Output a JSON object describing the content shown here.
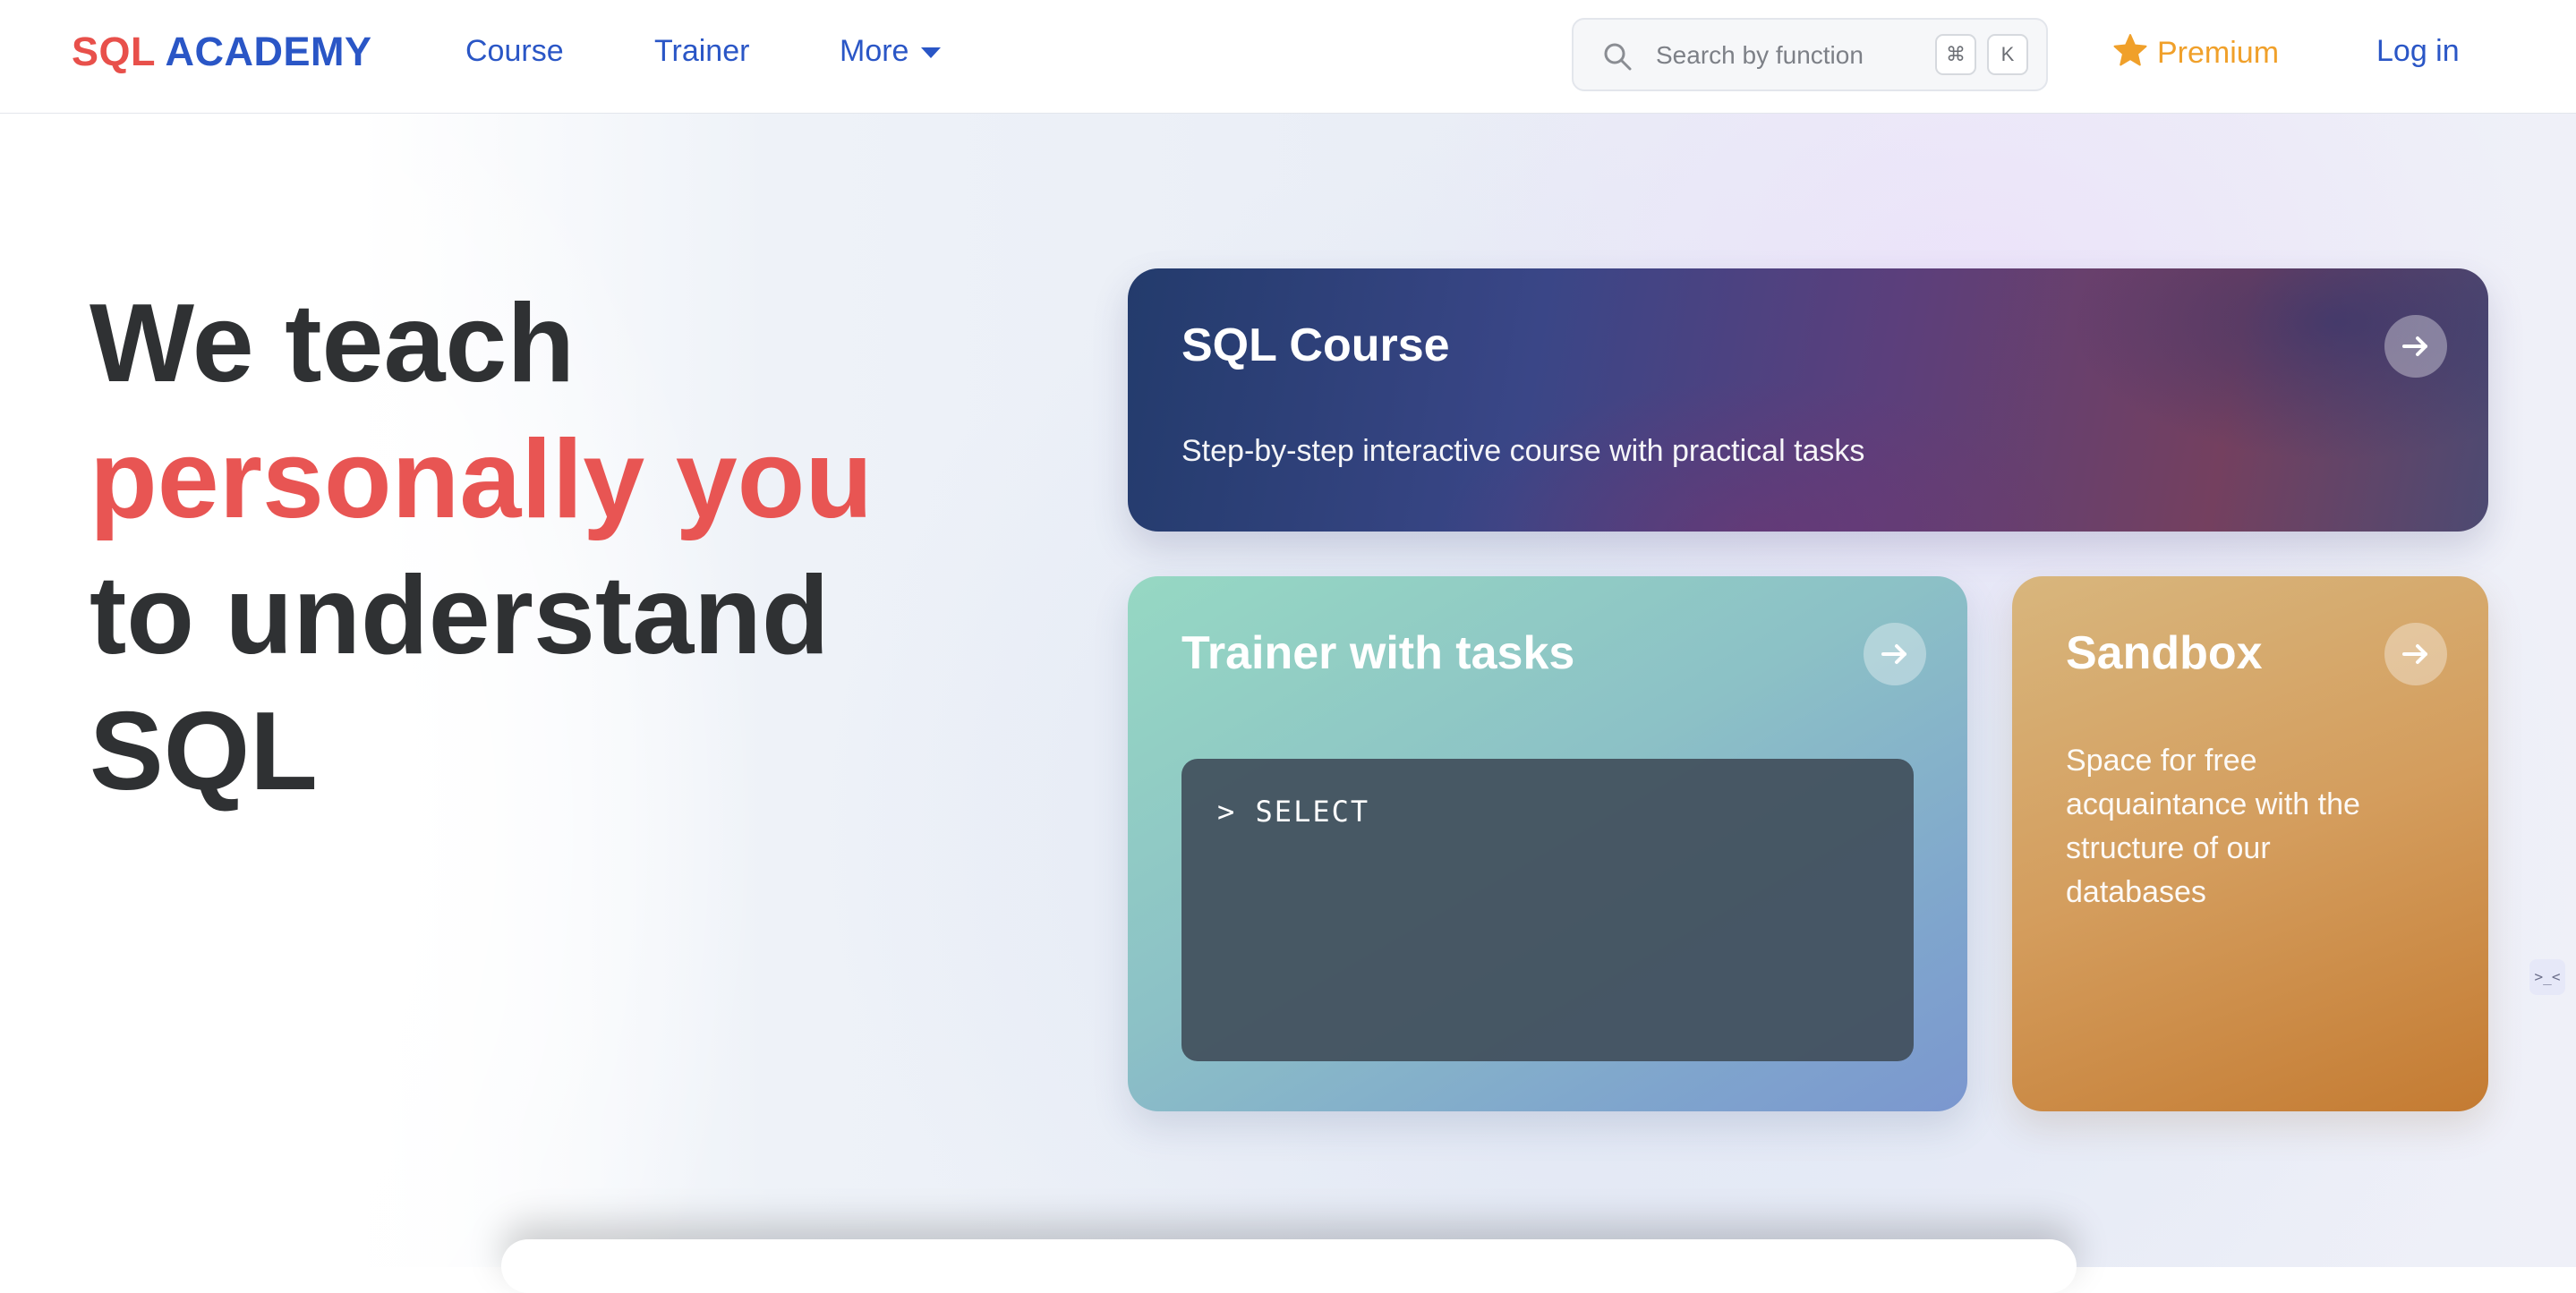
{
  "header": {
    "logo": {
      "part1": "SQL",
      "part2": "ACADEMY"
    },
    "nav": {
      "course": "Course",
      "trainer": "Trainer",
      "more": "More"
    },
    "search": {
      "placeholder": "Search by function",
      "shortcut_cmd": "⌘",
      "shortcut_key": "K"
    },
    "premium": "Premium",
    "login": "Log in"
  },
  "hero": {
    "line1": "We teach",
    "line2": "personally you",
    "line3": "to understand",
    "line4": "SQL"
  },
  "cards": {
    "course": {
      "title": "SQL Course",
      "description": "Step-by-step interactive course with practical tasks"
    },
    "trainer": {
      "title": "Trainer with tasks",
      "terminal_text": "> SELECT"
    },
    "sandbox": {
      "title": "Sandbox",
      "description_lines": [
        "Space for free",
        "acquaintance with the",
        "structure of our",
        "databases"
      ]
    }
  },
  "side_widget": ">_<",
  "colors": {
    "brand_red": "#e8504b",
    "brand_blue": "#2a56c6",
    "premium": "#f0a02a"
  }
}
